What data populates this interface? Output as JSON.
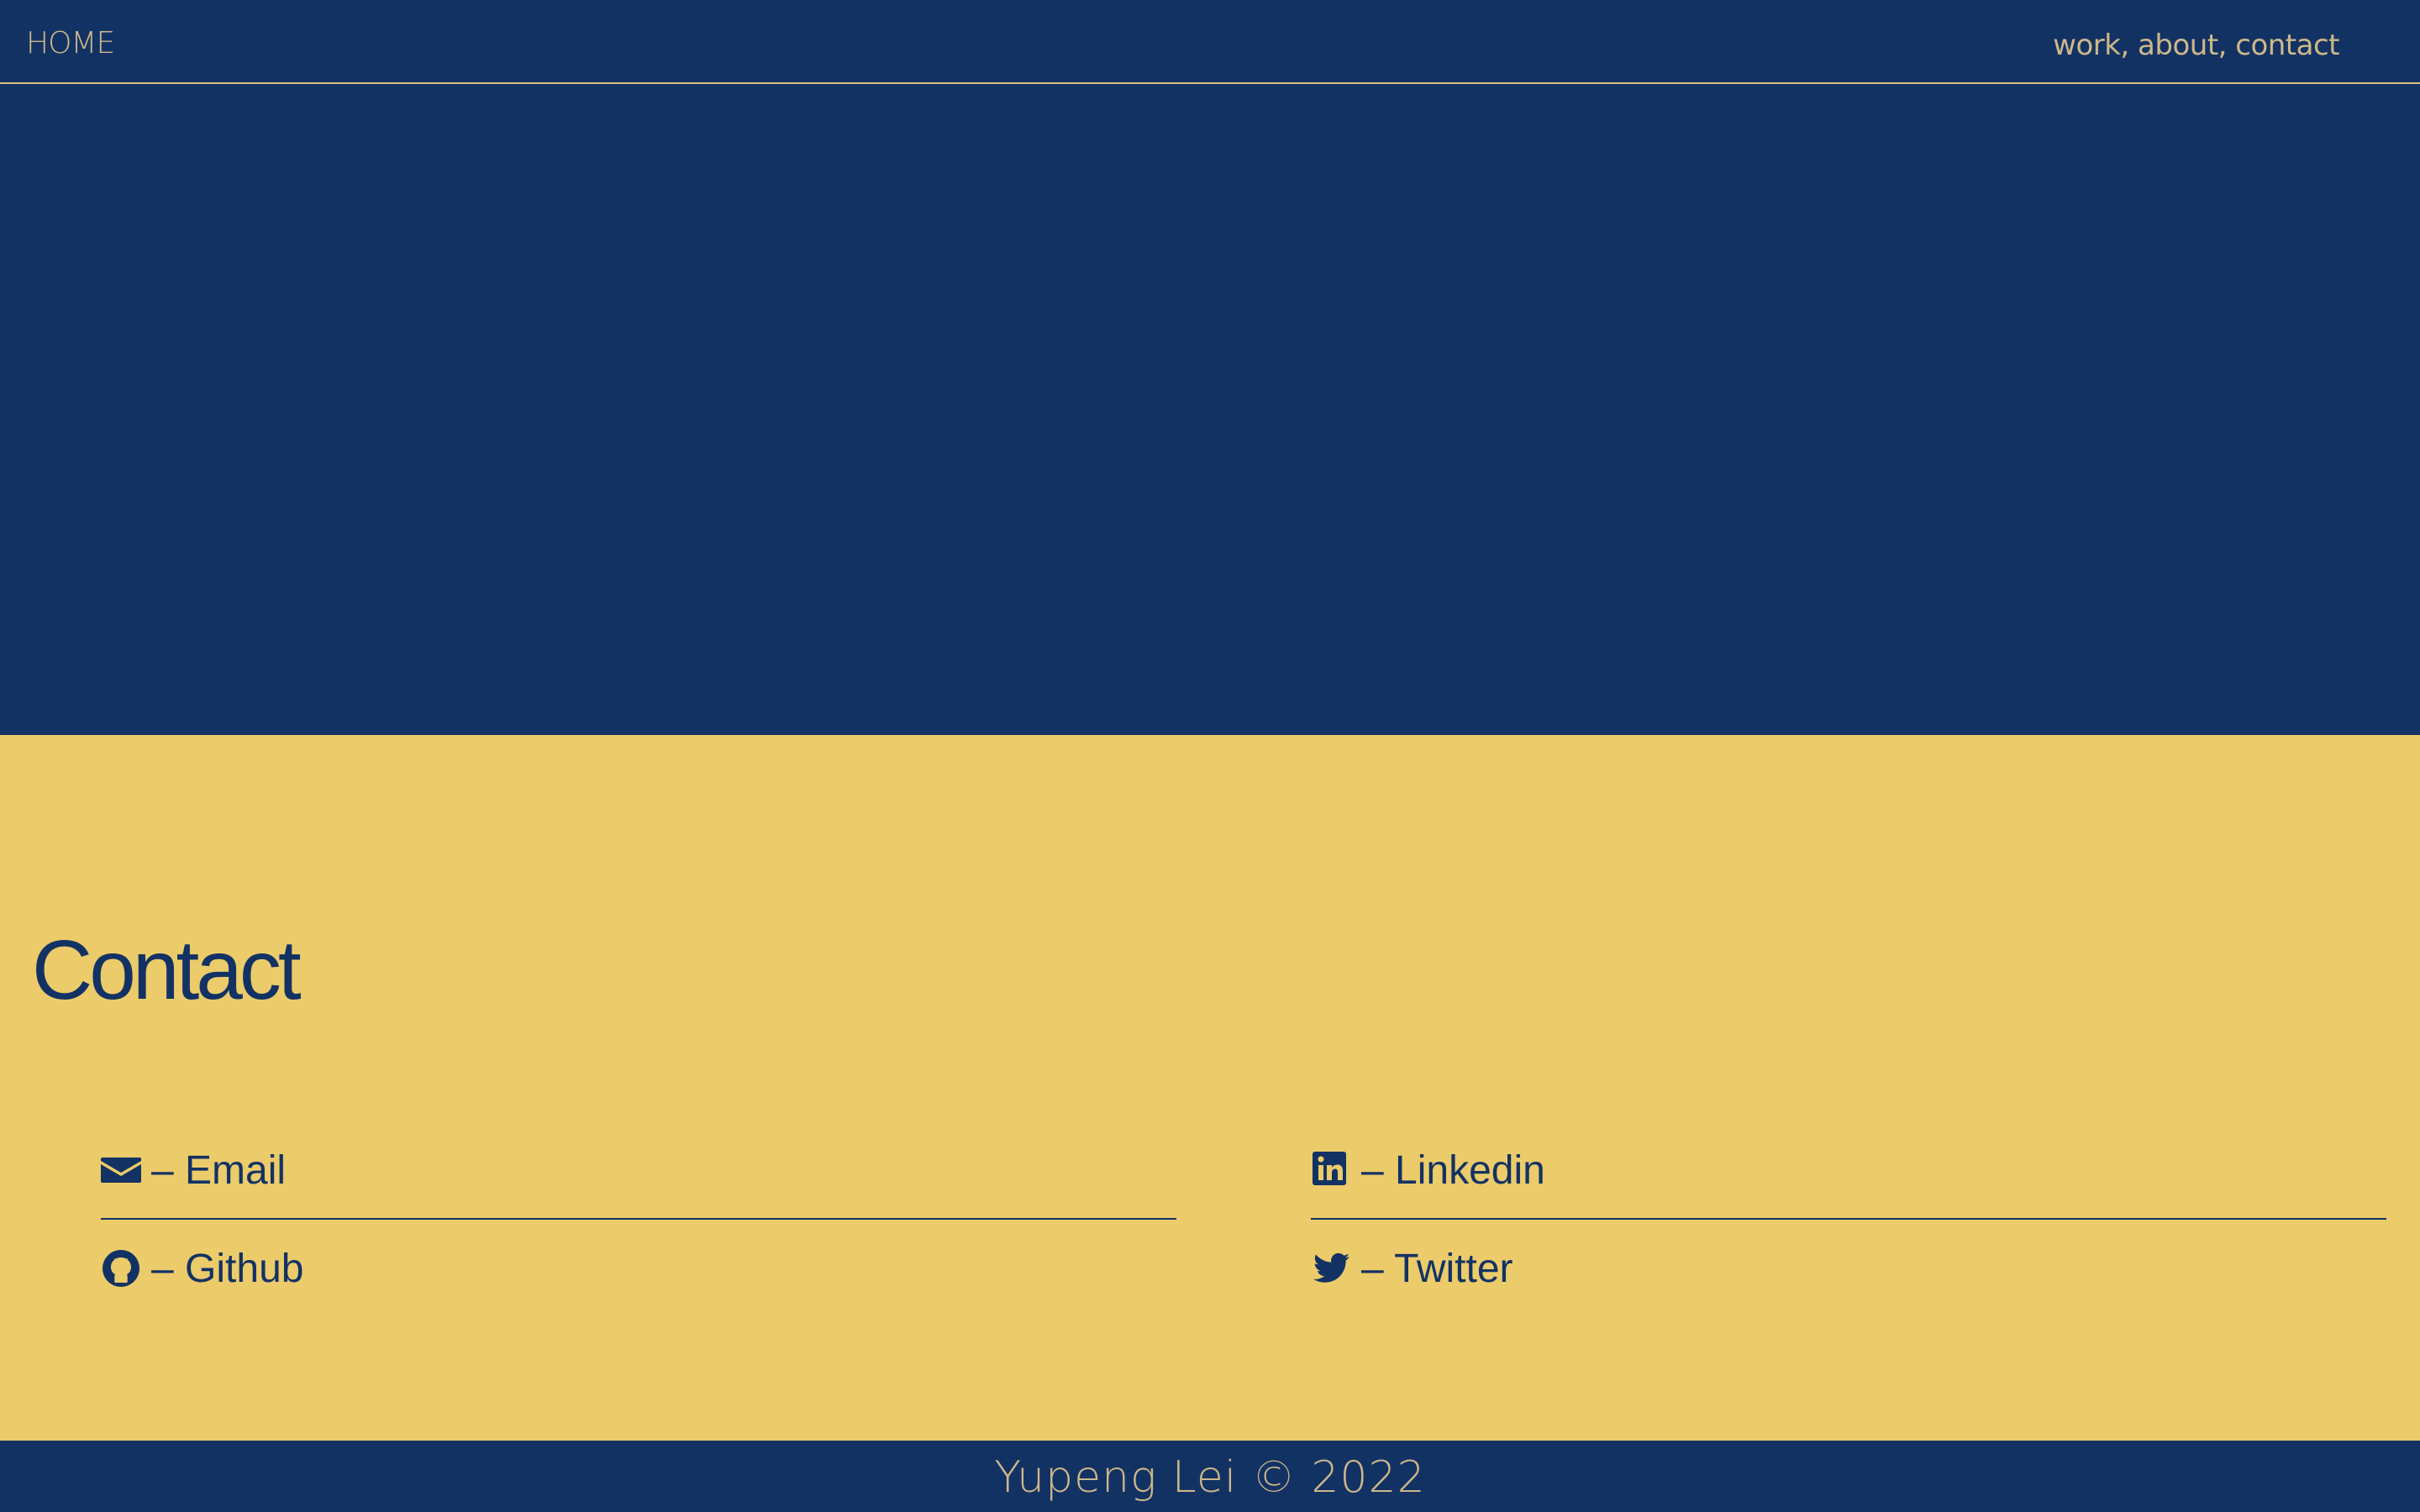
{
  "colors": {
    "navy": "#133264",
    "gold": "#ebcb6a",
    "nav_text": "#cdb889",
    "header_rule": "#d9c27a"
  },
  "header": {
    "home_label": "HOME",
    "nav_text": "work, about, contact"
  },
  "contact": {
    "title": "Contact",
    "links": [
      {
        "icon": "envelope-icon",
        "label": "– Email"
      },
      {
        "icon": "linkedin-icon",
        "label": "– Linkedin"
      },
      {
        "icon": "github-icon",
        "label": "– Github"
      },
      {
        "icon": "twitter-icon",
        "label": "– Twitter"
      }
    ]
  },
  "footer": {
    "text": "Yupeng Lei © 2022"
  }
}
